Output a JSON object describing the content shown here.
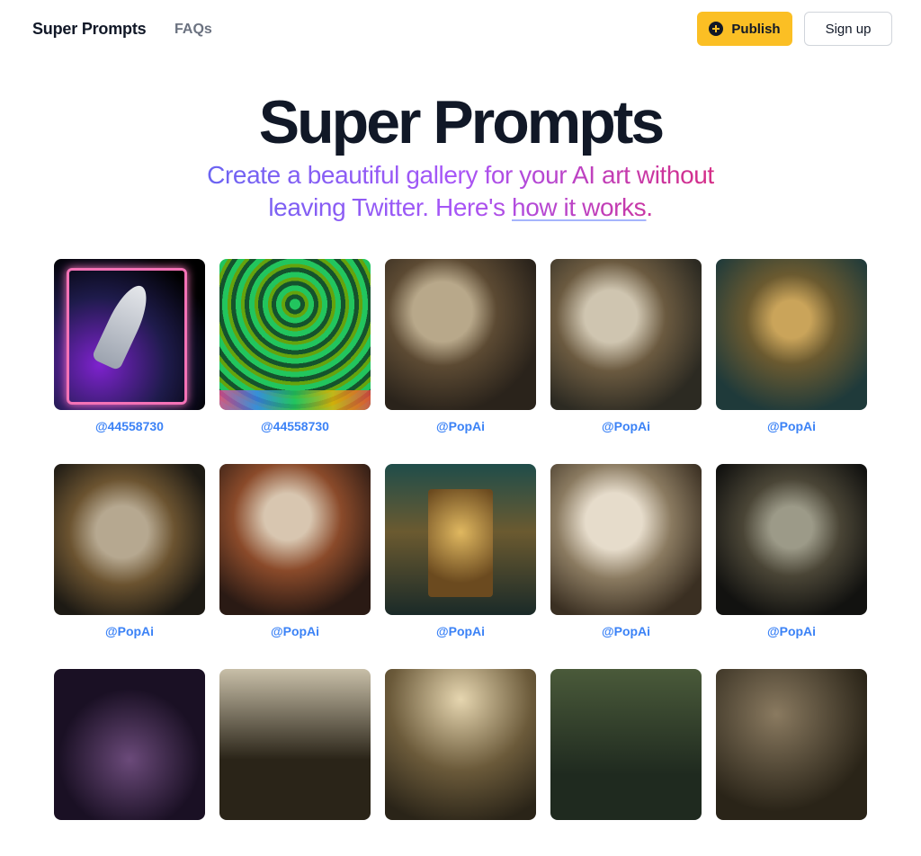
{
  "nav": {
    "brand": "Super Prompts",
    "faq_label": "FAQs",
    "publish_label": "Publish",
    "signup_label": "Sign up"
  },
  "hero": {
    "title": "Super Prompts",
    "subtitle_prefix": "Create a beautiful gallery for your AI art without leaving Twitter. Here's ",
    "subtitle_link": "how it works",
    "subtitle_suffix": "."
  },
  "gallery": {
    "items": [
      {
        "handle": "@44558730",
        "art": "rocket"
      },
      {
        "handle": "@44558730",
        "art": "green"
      },
      {
        "handle": "@PopAi",
        "art": "doll1"
      },
      {
        "handle": "@PopAi",
        "art": "doll2"
      },
      {
        "handle": "@PopAi",
        "art": "doll3"
      },
      {
        "handle": "@PopAi",
        "art": "doll4"
      },
      {
        "handle": "@PopAi",
        "art": "doll5"
      },
      {
        "handle": "@PopAi",
        "art": "doll6"
      },
      {
        "handle": "@PopAi",
        "art": "doll7"
      },
      {
        "handle": "@PopAi",
        "art": "doll8"
      },
      {
        "handle": "",
        "art": "dark1"
      },
      {
        "handle": "",
        "art": "dark2"
      },
      {
        "handle": "",
        "art": "dark3"
      },
      {
        "handle": "",
        "art": "dark4"
      },
      {
        "handle": "",
        "art": "dark5"
      }
    ]
  },
  "colors": {
    "accent": "#fbbf24",
    "handle": "#3b82f6",
    "text": "#111827"
  }
}
